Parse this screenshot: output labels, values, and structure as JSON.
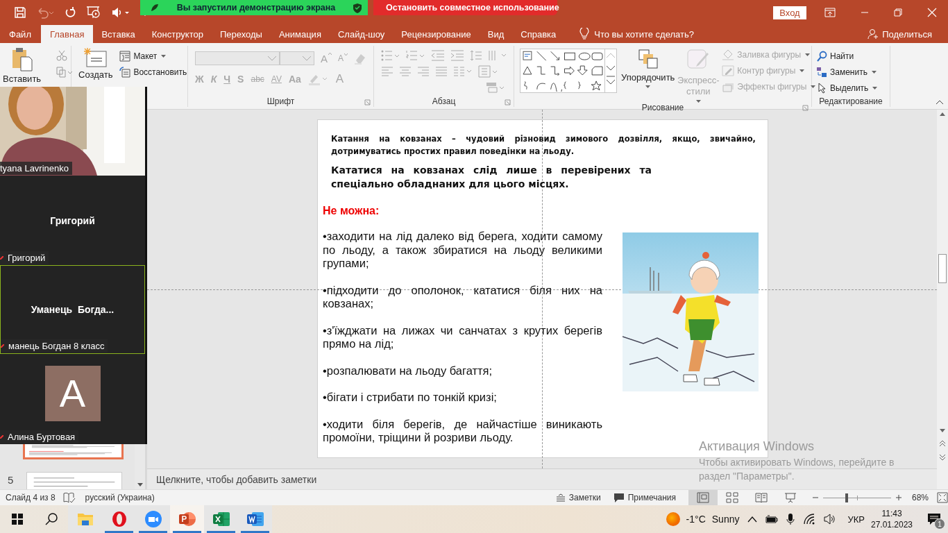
{
  "title_bar": {
    "share_notice": "Вы запустили демонстрацию экрана",
    "stop_share": "Остановить совместное использование",
    "sign_in": "Вход"
  },
  "tabs": [
    {
      "label": "Файл",
      "selected": false
    },
    {
      "label": "Главная",
      "selected": true
    },
    {
      "label": "Вставка",
      "selected": false
    },
    {
      "label": "Конструктор",
      "selected": false
    },
    {
      "label": "Переходы",
      "selected": false
    },
    {
      "label": "Анимация",
      "selected": false
    },
    {
      "label": "Слайд-шоу",
      "selected": false
    },
    {
      "label": "Рецензирование",
      "selected": false
    },
    {
      "label": "Вид",
      "selected": false
    },
    {
      "label": "Справка",
      "selected": false
    }
  ],
  "tell_me": "Что вы хотите сделать?",
  "share": "Поделиться",
  "ribbon": {
    "clipboard": {
      "paste": "Вставить"
    },
    "slides": {
      "new_slide": "Создать",
      "layout": "Макет",
      "reset": "Восстановить"
    },
    "font": {
      "label": "Шрифт",
      "grow": "A",
      "shrink": "A",
      "styles": [
        "Ж",
        "К",
        "Ч",
        "S",
        "abc"
      ],
      "spacing": "AV",
      "case": "Aa",
      "font_color_letter": "A"
    },
    "paragraph": {
      "label": "Абзац"
    },
    "drawing": {
      "label": "Рисование",
      "arrange": "Упорядочить",
      "quick_styles": {
        "label": "Экспресс-стили",
        "disabled": true
      },
      "format": [
        {
          "kind": "fill",
          "label": "Заливка фигуры",
          "disabled": true
        },
        {
          "kind": "outline",
          "label": "Контур фигуры",
          "disabled": true
        },
        {
          "kind": "effects",
          "label": "Эффекты фигуры",
          "disabled": true
        }
      ]
    },
    "editing": {
      "label": "Редактирование",
      "commands": [
        {
          "kind": "find",
          "label": "Найти"
        },
        {
          "kind": "replace",
          "label": "Заменить"
        },
        {
          "kind": "select",
          "label": "Выделить"
        }
      ]
    }
  },
  "meeting": {
    "tiles": [
      {
        "kind": "video",
        "name": "tyana Lavrinenko",
        "active": false
      },
      {
        "kind": "name",
        "title": "Григорий",
        "name": "Григорий",
        "active": false
      },
      {
        "kind": "name",
        "title": "Уманець  Богда...",
        "name": "манець Богдан 8 класс",
        "active": true
      },
      {
        "kind": "avatar",
        "initial": "A",
        "name": "Алина Буртовая",
        "active": false
      }
    ]
  },
  "thumbnails": [
    {
      "selected": true
    },
    {
      "number": "5",
      "selected": false
    }
  ],
  "slide": {
    "intro": "Катання на ковзанах – чудовий різновид  зимового дозвілля, якщо, звичайно, дотримуватись простих правил поведінки на льоду.",
    "rule": "Кататися на ковзанах слід лише в перевірених та спеціально обладнаних для цього місцях.",
    "heading": "Не можна:",
    "bullets": [
      "•заходити на лід далеко від берега, ходити самому по льоду, а також збиратися на льоду великими групами;",
      "•підходити до ополонок,   кататися біля них на ковзанах;",
      "•з'їжджати на лижах чи санчатах з крутих берегів  прямо на лід;",
      "•розпалювати на льоду багаття;",
      "•бігати і стрибати по тонкій кризі;",
      "•ходити біля берегів, де найчастіше виникають промоїни, тріщини й розриви льоду."
    ]
  },
  "notes": {
    "placeholder": "Щелкните, чтобы добавить заметки"
  },
  "activation": {
    "title": "Активация Windows",
    "text": "Чтобы активировать Windows, перейдите в раздел \"Параметры\"."
  },
  "status_bar": {
    "slide": "Слайд 4 из 8",
    "language": "русский (Украина)",
    "notes": "Заметки",
    "comments": "Примечания",
    "views": [
      {
        "kind": "normal",
        "selected": true
      },
      {
        "kind": "sorter",
        "selected": false
      },
      {
        "kind": "reading",
        "selected": false
      },
      {
        "kind": "slideshow",
        "selected": false
      }
    ],
    "zoom": {
      "level": 0.35
    },
    "zoom_label": "68%"
  },
  "taskbar": {
    "apps": [
      {
        "kind": "explorer",
        "running": false,
        "selected": false
      },
      {
        "kind": "opera",
        "running": true,
        "selected": false
      },
      {
        "kind": "zoom",
        "running": true,
        "selected": false
      },
      {
        "kind": "powerpoint",
        "running": true,
        "selected": true
      },
      {
        "kind": "excel",
        "running": true,
        "selected": false
      },
      {
        "kind": "word",
        "running": true,
        "selected": false
      }
    ],
    "weather": {
      "temp": "-1°C",
      "text": "Sunny"
    },
    "language": "УКР",
    "time": "11:43",
    "date": "27.01.2023",
    "notifications": "1"
  }
}
